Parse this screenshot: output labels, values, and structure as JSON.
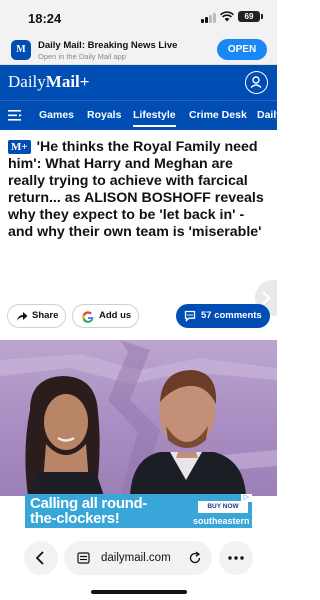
{
  "status_bar": {
    "time": "18:24",
    "battery": "69"
  },
  "app_banner": {
    "icon_text": "M",
    "title": "Daily Mail: Breaking News Live",
    "subtitle": "Open in the Daily Mail app",
    "open_label": "OPEN"
  },
  "masthead": {
    "logo_prefix": "Daily",
    "logo_brand": "Mail+"
  },
  "nav": {
    "items": [
      {
        "label": "Games",
        "active": false
      },
      {
        "label": "Royals",
        "active": false
      },
      {
        "label": "Lifestyle",
        "active": true
      },
      {
        "label": "Crime Desk",
        "active": false
      },
      {
        "label": "Daily",
        "active": false
      }
    ]
  },
  "article": {
    "badge": "M+",
    "headline": "'He thinks the Royal Family need him': What Harry and Meghan are really trying to achieve with farcical return... as ALISON BOSHOFF reveals why they expect to be 'let back in' - and why their own team is 'miserable'"
  },
  "actions": {
    "share_label": "Share",
    "add_label": "Add us",
    "comments_label": "57 comments"
  },
  "ad": {
    "line1": "Calling all round-",
    "line2": "the-clockers!",
    "cta": "BUY NOW",
    "brand": "southeastern",
    "adchoice": "▷"
  },
  "browser": {
    "url": "dailymail.com"
  },
  "colors": {
    "brand_blue": "#004db3",
    "banner_open": "#1b87f5",
    "ad_blue": "#38a6d8",
    "hero_purple": "#a98dc2"
  }
}
